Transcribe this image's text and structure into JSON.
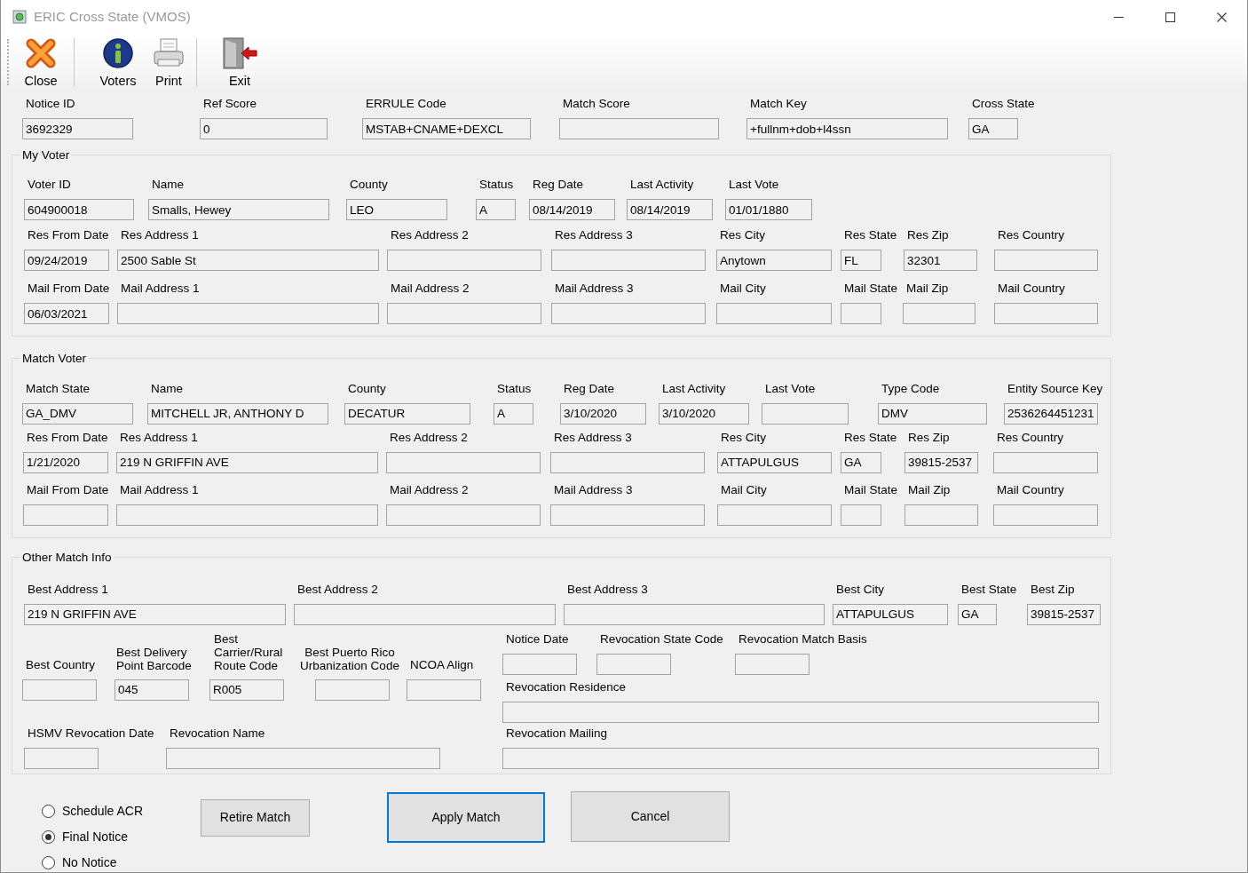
{
  "window": {
    "title": "ERIC Cross State (VMOS)"
  },
  "toolbar": [
    {
      "label": "Close",
      "kind": "close"
    },
    {
      "label": "Voters",
      "kind": "voters"
    },
    {
      "label": "Print",
      "kind": "print"
    },
    {
      "label": "Exit",
      "kind": "exit"
    }
  ],
  "header": {
    "fields": [
      {
        "label": "Notice ID",
        "value": "3692329"
      },
      {
        "label": "Ref Score",
        "value": "0"
      },
      {
        "label": "ERRULE Code",
        "value": "MSTAB+CNAME+DEXCL"
      },
      {
        "label": "Match Score"
      },
      {
        "label": "Match Key",
        "value": "+fullnm+dob+l4ssn"
      },
      {
        "label": "Cross State",
        "value": "GA"
      }
    ]
  },
  "my_voter": {
    "title": "My Voter",
    "lines": [
      {
        "fields": [
          {
            "label": "Voter ID",
            "value": "604900018"
          },
          {
            "label": "Name",
            "value": "Smalls, Hewey"
          },
          {
            "label": "County",
            "value": "LEO"
          },
          {
            "label": "Status",
            "value": "A"
          },
          {
            "label": "Reg Date",
            "value": "08/14/2019"
          },
          {
            "label": "Last Activity",
            "value": "08/14/2019"
          },
          {
            "label": "Last Vote",
            "value": "01/01/1880"
          }
        ]
      },
      {
        "fields": [
          {
            "label": "Res From Date",
            "value": "09/24/2019"
          },
          {
            "label": "Res Address 1",
            "value": "2500 Sable St"
          },
          {
            "label": "Res Address 2"
          },
          {
            "label": "Res Address 3"
          },
          {
            "label": "Res City",
            "value": "Anytown"
          },
          {
            "label": "Res State",
            "value": "FL"
          },
          {
            "label": "Res Zip",
            "value": "32301"
          },
          {
            "label": "Res Country"
          }
        ]
      },
      {
        "fields": [
          {
            "label": "Mail From Date",
            "value": "06/03/2021"
          },
          {
            "label": "Mail Address 1"
          },
          {
            "label": "Mail Address 2"
          },
          {
            "label": "Mail Address 3"
          },
          {
            "label": "Mail City"
          },
          {
            "label": "Mail State"
          },
          {
            "label": "Mail Zip"
          },
          {
            "label": "Mail Country"
          }
        ]
      }
    ]
  },
  "match_voter": {
    "title": "Match Voter",
    "lines": [
      {
        "fields": [
          {
            "label": "Match State",
            "value": "GA_DMV"
          },
          {
            "label": "Name",
            "value": "MITCHELL JR, ANTHONY D"
          },
          {
            "label": "County",
            "value": "DECATUR"
          },
          {
            "label": "Status",
            "value": "A"
          },
          {
            "label": "Reg Date",
            "value": "3/10/2020"
          },
          {
            "label": "Last Activity",
            "value": "3/10/2020"
          },
          {
            "label": "Last Vote"
          },
          {
            "label": "Type Code",
            "value": "DMV"
          },
          {
            "label": "Entity Source Key",
            "value": "2536264451231"
          }
        ]
      },
      {
        "fields": [
          {
            "label": "Res From Date",
            "value": "1/21/2020"
          },
          {
            "label": "Res Address 1",
            "value": "219 N GRIFFIN AVE"
          },
          {
            "label": "Res Address 2"
          },
          {
            "label": "Res Address 3"
          },
          {
            "label": "Res City",
            "value": "ATTAPULGUS"
          },
          {
            "label": "Res State",
            "value": "GA"
          },
          {
            "label": "Res Zip",
            "value": "39815-2537"
          },
          {
            "label": "Res Country"
          }
        ]
      },
      {
        "fields": [
          {
            "label": "Mail From Date"
          },
          {
            "label": "Mail Address 1"
          },
          {
            "label": "Mail Address 2"
          },
          {
            "label": "Mail Address 3"
          },
          {
            "label": "Mail City"
          },
          {
            "label": "Mail State"
          },
          {
            "label": "Mail Zip"
          },
          {
            "label": "Mail Country"
          }
        ]
      }
    ]
  },
  "other_match_info": {
    "title": "Other Match Info",
    "best_row": [
      {
        "label": "Best Address 1",
        "value": "219 N GRIFFIN AVE"
      },
      {
        "label": "Best Address 2"
      },
      {
        "label": "Best Address 3"
      },
      {
        "label": "Best City",
        "value": "ATTAPULGUS"
      },
      {
        "label": "Best State",
        "value": "GA"
      },
      {
        "label": "Best Zip",
        "value": "39815-2537"
      }
    ],
    "codes_row": [
      {
        "label": "Best Country"
      },
      {
        "label": "Best Delivery Point Barcode",
        "value": "045"
      },
      {
        "label": "Best Carrier/Rural Route Code",
        "value": "R005"
      },
      {
        "label": "Best Puerto Rico Urbanization Code"
      },
      {
        "label": "NCOA Align"
      }
    ],
    "revocation_left": [
      {
        "label": "HSMV Revocation Date"
      },
      {
        "label": "Revocation Name"
      }
    ],
    "notice_row": [
      {
        "label": "Notice Date"
      },
      {
        "label": "Revocation State Code"
      },
      {
        "label": "Revocation Match Basis"
      }
    ],
    "revocation_residence": {
      "label": "Revocation Residence"
    },
    "revocation_mailing": {
      "label": "Revocation Mailing"
    }
  },
  "notice_options": [
    {
      "label": "Schedule ACR",
      "selected": false
    },
    {
      "label": "Final Notice",
      "selected": true
    },
    {
      "label": "No Notice",
      "selected": false
    }
  ],
  "buttons": [
    {
      "label": "Retire Match",
      "default": false
    },
    {
      "label": "Apply Match",
      "default": true
    },
    {
      "label": "Cancel",
      "default": false
    }
  ]
}
